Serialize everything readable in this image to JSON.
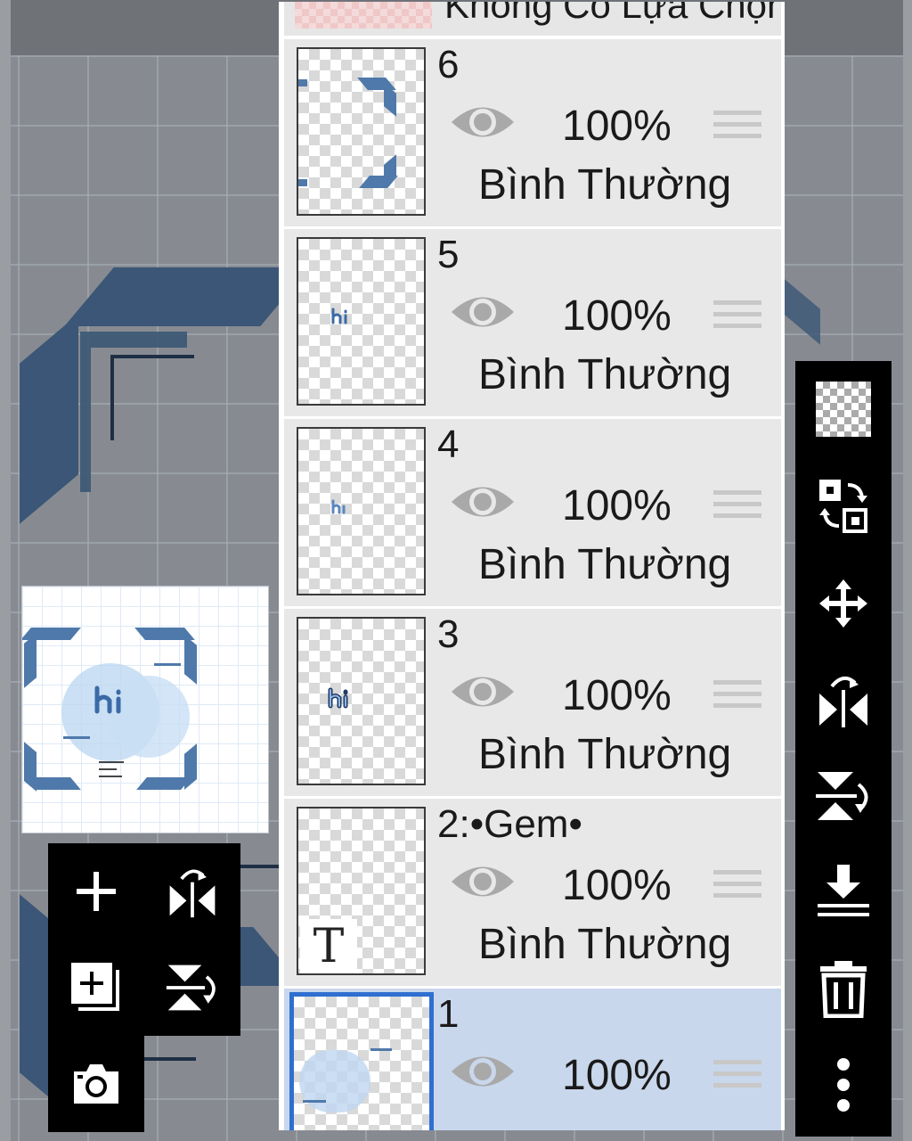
{
  "selection_row": {
    "label": "Không Có Lựa Chọn"
  },
  "layers": [
    {
      "name": "6",
      "opacity": "100%",
      "blend": "Bình Thường",
      "visible_icon": "eye-icon",
      "type": "image"
    },
    {
      "name": "5",
      "opacity": "100%",
      "blend": "Bình Thường",
      "visible_icon": "eye-icon",
      "type": "image"
    },
    {
      "name": "4",
      "opacity": "100%",
      "blend": "Bình Thường",
      "visible_icon": "eye-icon",
      "type": "image"
    },
    {
      "name": "3",
      "opacity": "100%",
      "blend": "Bình Thường",
      "visible_icon": "eye-icon",
      "type": "image"
    },
    {
      "name": "2:•Gem•",
      "opacity": "100%",
      "blend": "Bình Thường",
      "visible_icon": "eye-icon",
      "type": "text",
      "badge": "T"
    },
    {
      "name": "1",
      "opacity": "100%",
      "blend": "Bình Thường",
      "visible_icon": "eye-icon",
      "type": "image",
      "selected": true
    }
  ],
  "right_toolbar": [
    "transparency-icon",
    "swap-layers-icon",
    "move-icon",
    "flip-horizontal-icon",
    "flip-vertical-icon",
    "merge-down-icon",
    "trash-icon",
    "more-icon"
  ],
  "left_toolbar": [
    "add-layer-icon",
    "flip-horizontal-icon",
    "add-layer-copy-icon",
    "flip-vertical-icon",
    "camera-icon"
  ],
  "colors": {
    "accent": "#2f6fd0",
    "selected_row": "#c9d7ec",
    "row": "#e8e8e8",
    "deco_blue": "#3b5676"
  }
}
